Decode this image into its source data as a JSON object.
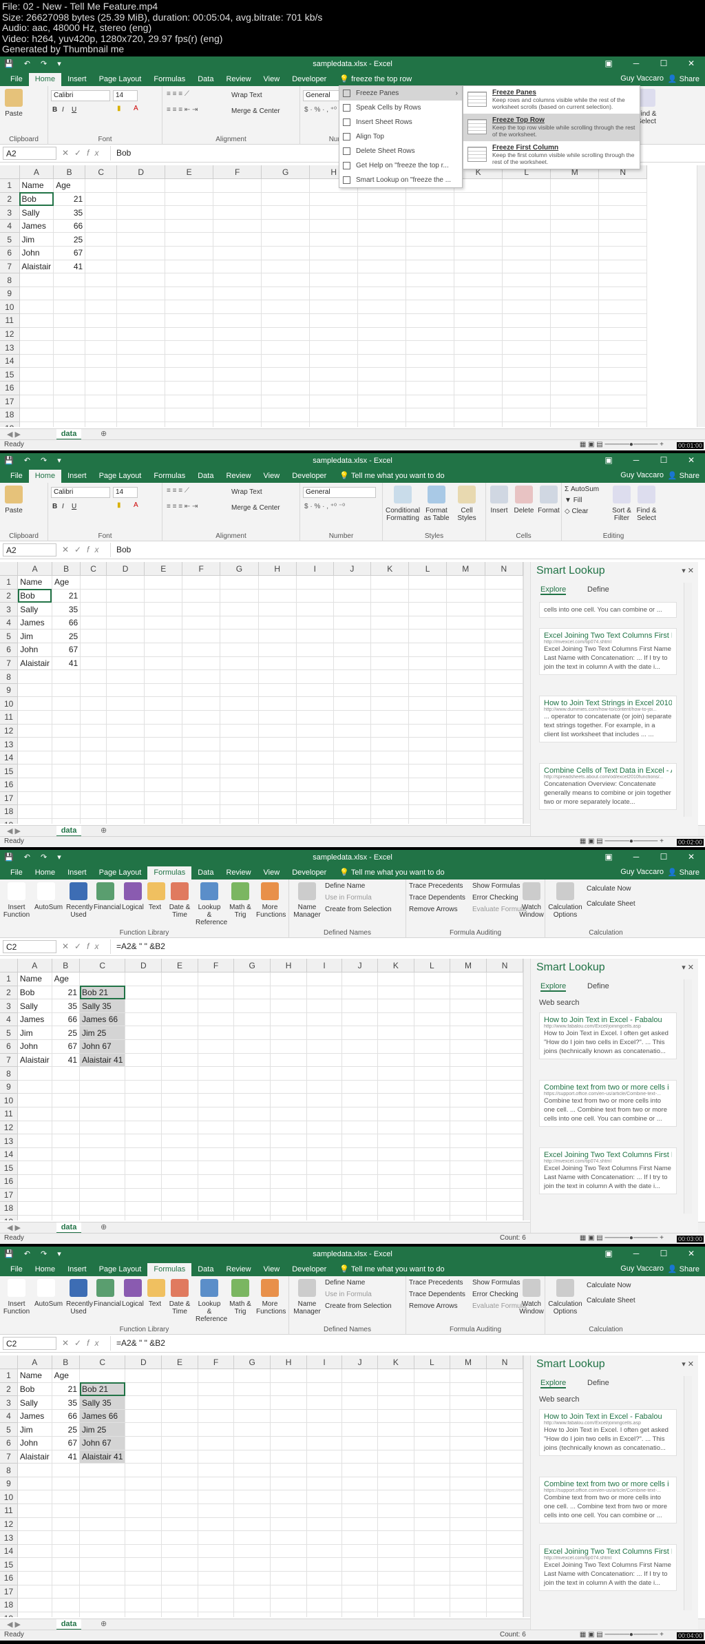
{
  "header": {
    "lines": [
      "File: 02 - New - Tell Me Feature.mp4",
      "Size: 26627098 bytes (25.39 MiB), duration: 00:05:04, avg.bitrate: 701 kb/s",
      "Audio: aac, 48000 Hz, stereo (eng)",
      "Video: h264, yuv420p, 1280x720, 29.97 fps(r) (eng)",
      "Generated by Thumbnail me"
    ]
  },
  "app": {
    "title": "sampledata.xlsx - Excel",
    "user": "Guy Vaccaro",
    "share": "Share",
    "sheet": "data",
    "status": "Ready",
    "tell_placeholder": "Tell me what you want to do",
    "tell_query": "freeze the top row"
  },
  "tabs": [
    "File",
    "Home",
    "Insert",
    "Page Layout",
    "Formulas",
    "Data",
    "Review",
    "View",
    "Developer"
  ],
  "columns": [
    "A",
    "B",
    "C",
    "D",
    "E",
    "F",
    "G",
    "H",
    "I",
    "J",
    "K",
    "L",
    "M",
    "N"
  ],
  "rows": [
    [
      "Name",
      "Age",
      ""
    ],
    [
      "Bob",
      "21",
      "Bob 21"
    ],
    [
      "Sally",
      "35",
      "Sally 35"
    ],
    [
      "James",
      "66",
      "James 66"
    ],
    [
      "Jim",
      "25",
      "Jim 25"
    ],
    [
      "John",
      "67",
      "John 67"
    ],
    [
      "Alaistair",
      "41",
      "Alaistair 41"
    ]
  ],
  "frames": [
    {
      "namebox": "A2",
      "formula": "Bob",
      "tab": "Home",
      "count": ""
    },
    {
      "namebox": "A2",
      "formula": "Bob",
      "tab": "Home",
      "count": ""
    },
    {
      "namebox": "C2",
      "formula": "=A2& \" \" &B2",
      "tab": "Formulas",
      "count": "Count: 6"
    },
    {
      "namebox": "C2",
      "formula": "=A2& \" \" &B2",
      "tab": "Formulas",
      "count": "Count: 6"
    }
  ],
  "home_ribbon": {
    "clipboard": "Clipboard",
    "font": "Font",
    "alignment": "Alignment",
    "number": "Number",
    "styles": "Styles",
    "cells": "Cells",
    "editing": "Editing",
    "paste": "Paste",
    "font_name": "Calibri",
    "font_size": "14",
    "wrap": "Wrap Text",
    "merge": "Merge & Center",
    "general": "General",
    "cond": "Conditional Formatting",
    "fmt_table": "Format as Table",
    "cell_styles": "Cell Styles",
    "insert": "Insert",
    "delete": "Delete",
    "format": "Format",
    "autosum": "AutoSum",
    "fill": "Fill",
    "clear": "Clear",
    "sort": "Sort & Filter",
    "find": "Find & Select"
  },
  "formulas_ribbon": {
    "insert_fn": "Insert Function",
    "autosum": "AutoSum",
    "recent": "Recently Used",
    "financial": "Financial",
    "logical": "Logical",
    "text": "Text",
    "datetime": "Date & Time",
    "lookup": "Lookup & Reference",
    "math": "Math & Trig",
    "more": "More Functions",
    "lib": "Function Library",
    "name_mgr": "Name Manager",
    "define": "Define Name",
    "use": "Use in Formula",
    "create": "Create from Selection",
    "defined": "Defined Names",
    "trace_p": "Trace Precedents",
    "trace_d": "Trace Dependents",
    "remove": "Remove Arrows",
    "show": "Show Formulas",
    "err": "Error Checking",
    "eval": "Evaluate Formula",
    "auditing": "Formula Auditing",
    "watch": "Watch Window",
    "calc_opt": "Calculation Options",
    "calc_now": "Calculate Now",
    "calc_sheet": "Calculate Sheet",
    "calc": "Calculation"
  },
  "tellme_menu": [
    "Freeze Panes",
    "Speak Cells by Rows",
    "Insert Sheet Rows",
    "Align Top",
    "Delete Sheet Rows",
    "Get Help on \"freeze the top r...",
    "Smart Lookup on \"freeze the ..."
  ],
  "freeze_sub": [
    {
      "title": "Freeze Panes",
      "desc": "Keep rows and columns visible while the rest of the worksheet scrolls (based on current selection)."
    },
    {
      "title": "Freeze Top Row",
      "desc": "Keep the top row visible while scrolling through the rest of the worksheet."
    },
    {
      "title": "Freeze First Column",
      "desc": "Keep the first column visible while scrolling through the rest of the worksheet."
    }
  ],
  "smart_lookup": {
    "title": "Smart Lookup",
    "explore": "Explore",
    "define": "Define",
    "web": "Web search",
    "frame2": [
      {
        "title": "",
        "url": "",
        "body": "cells into one cell. You can combine or ..."
      },
      {
        "title": "Excel Joining Two Text Columns First N",
        "url": "http://mvexcel.com/tip074.shtml",
        "body": "Excel Joining Two Text Columns First Name Last Name with Concatenation: ... If I try to join the text in column A with the date i..."
      },
      {
        "title": "How to Join Text Strings in Excel 2010",
        "url": "http://www.dummies.com/how-to/content/how-to-joi...",
        "body": "... operator to concatenate (or join) separate text strings together. For example, in a client list worksheet that includes ... ..."
      },
      {
        "title": "Combine Cells of Text Data in Excel - A",
        "url": "http://spreadsheets.about.com/od/excel2010functions/...",
        "body": "Concatenation Overview: Concatenate generally means to combine or join together two or more separately locate..."
      }
    ],
    "frame3": [
      {
        "title": "How to Join Text in Excel - Fabalou",
        "url": "http://www.fabalou.com/Excel/joiningcells.asp",
        "body": "How to Join Text in Excel. I often get asked \"How do I join two cells in Excel?\". ... This joins (technically known as concatenatio..."
      },
      {
        "title": "Combine text from two or more cells i",
        "url": "https://support.office.com/en-us/article/Combine-text-...",
        "body": "Combine text from two or more cells into one cell. ... Combine text from two or more cells into one cell. You can combine or ..."
      },
      {
        "title": "Excel Joining Two Text Columns First N",
        "url": "http://mvexcel.com/tip074.shtml",
        "body": "Excel Joining Two Text Columns First Name Last Name with Concatenation: ... If I try to join the text in column A with the date i..."
      }
    ]
  },
  "timestamps": [
    "00:01:00",
    "00:02:00",
    "00:03:00",
    "00:04:00"
  ],
  "colors": {
    "excel_green": "#217346",
    "selection": "#d4d4d4"
  }
}
